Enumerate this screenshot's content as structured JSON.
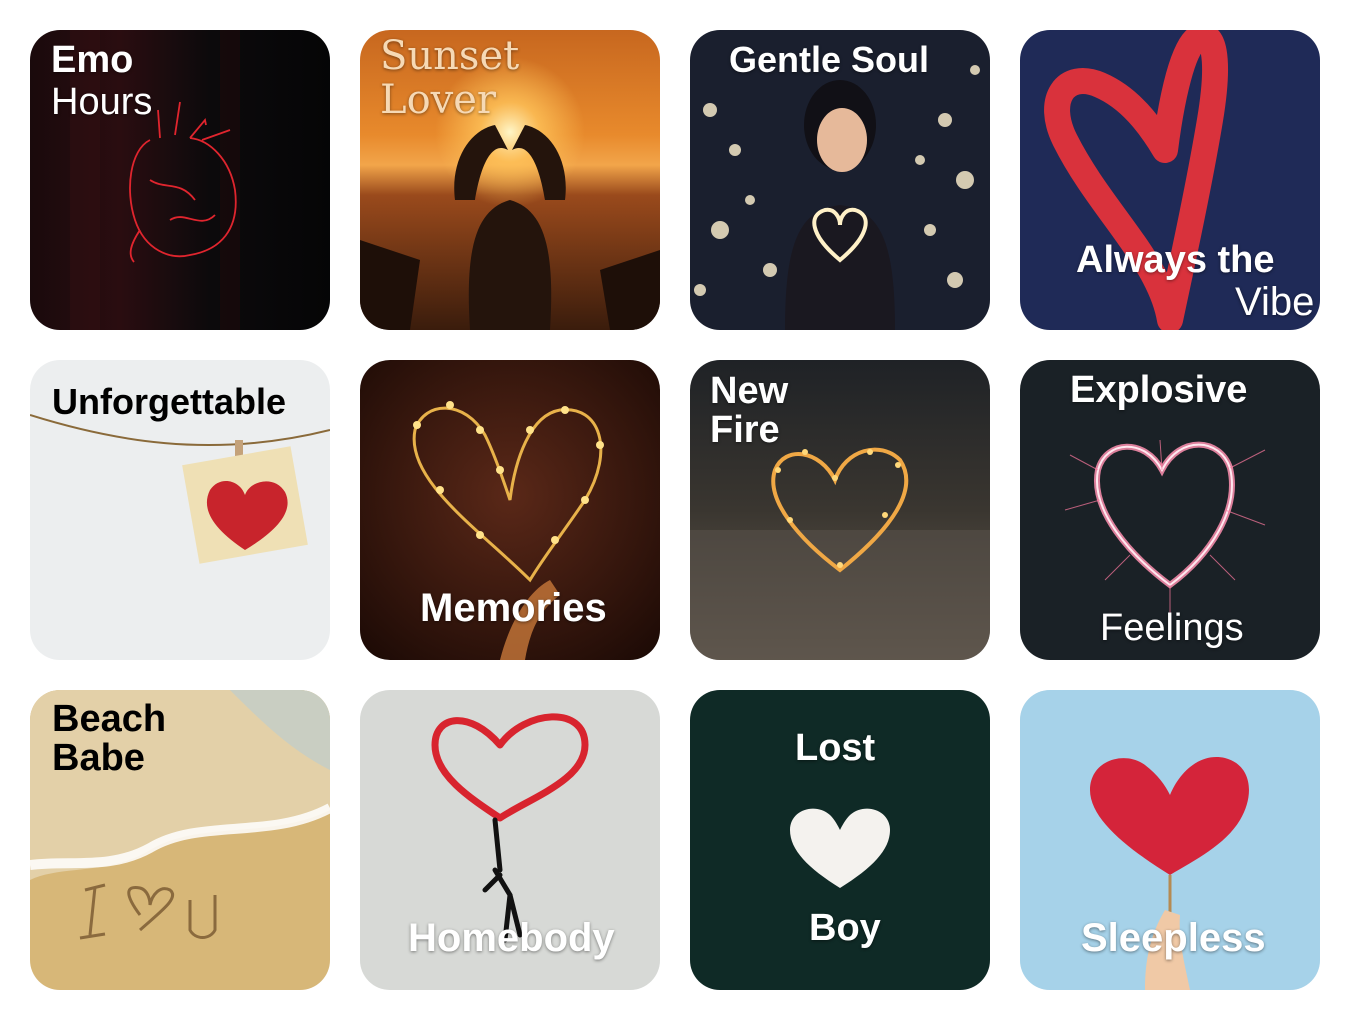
{
  "tiles": [
    {
      "lines": [
        "Emo",
        "Hours"
      ]
    },
    {
      "lines": [
        "Sunset",
        "Lover"
      ]
    },
    {
      "lines": [
        "Gentle Soul"
      ]
    },
    {
      "lines": [
        "Always the",
        "Vibe"
      ]
    },
    {
      "lines": [
        "Unforgettable"
      ]
    },
    {
      "lines": [
        "Memories"
      ]
    },
    {
      "lines": [
        "New",
        "Fire"
      ]
    },
    {
      "lines": [
        "Explosive",
        "Feelings"
      ]
    },
    {
      "lines": [
        "Beach",
        "Babe"
      ]
    },
    {
      "lines": [
        "Homebody"
      ]
    },
    {
      "lines": [
        "Lost",
        "Boy"
      ]
    },
    {
      "lines": [
        "Sleepless"
      ]
    }
  ],
  "images": [
    "anatomical-heart-drawing",
    "hands-heart-at-sunset",
    "woman-holding-heart-lights",
    "red-painted-heart",
    "paper-heart-on-string",
    "heart-fairy-lights",
    "glowing-heart-wire-on-sand",
    "sparkler-heart",
    "heart-written-in-sand",
    "heart-balloon-graffiti",
    "white-heart-on-green-wall",
    "paper-heart-on-stick"
  ],
  "colors": {
    "accent_red": "#e0303a",
    "label_white": "#ffffff",
    "label_black": "#000000"
  }
}
